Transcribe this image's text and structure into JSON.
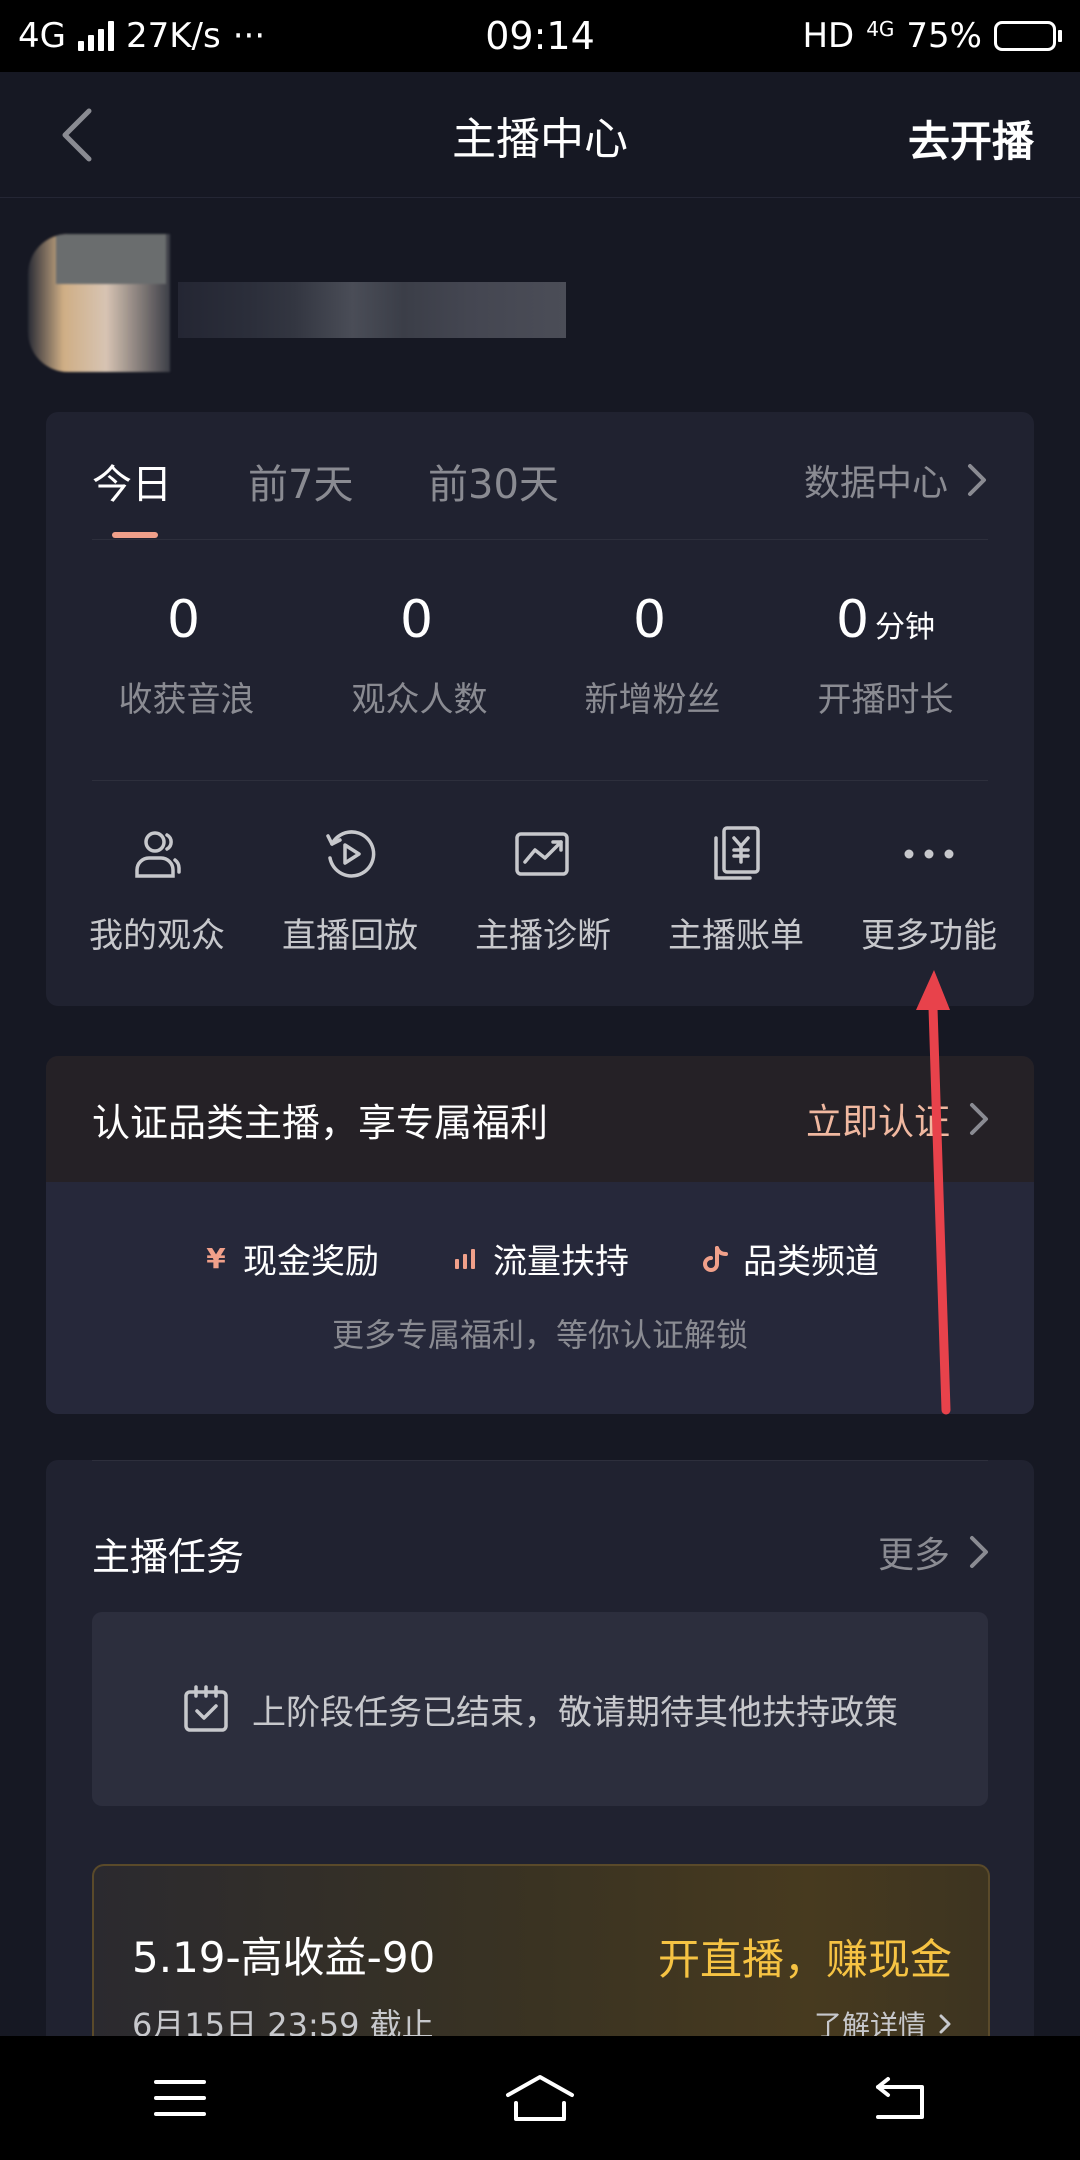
{
  "status_bar": {
    "network": "4G",
    "speed": "27K/s",
    "more": "···",
    "time": "09:14",
    "hd": "HD",
    "net2": "4G",
    "battery": "75%",
    "battery_level": 0.75
  },
  "header": {
    "title": "主播中心",
    "action": "去开播"
  },
  "stats": {
    "tabs": [
      "今日",
      "前7天",
      "前30天"
    ],
    "active_tab": 0,
    "data_center": "数据中心",
    "items": [
      {
        "value": "0",
        "unit": "",
        "label": "收获音浪"
      },
      {
        "value": "0",
        "unit": "",
        "label": "观众人数"
      },
      {
        "value": "0",
        "unit": "",
        "label": "新增粉丝"
      },
      {
        "value": "0",
        "unit": "分钟",
        "label": "开播时长"
      }
    ]
  },
  "tools": [
    {
      "label": "我的观众",
      "icon": "audience-icon"
    },
    {
      "label": "直播回放",
      "icon": "replay-icon"
    },
    {
      "label": "主播诊断",
      "icon": "diagnosis-icon"
    },
    {
      "label": "主播账单",
      "icon": "bill-icon"
    },
    {
      "label": "更多功能",
      "icon": "more-icon"
    }
  ],
  "certification": {
    "title": "认证品类主播，享专属福利",
    "action": "立即认证",
    "benefits": [
      {
        "label": "现金奖励",
        "icon": "yen-icon"
      },
      {
        "label": "流量扶持",
        "icon": "bars-icon"
      },
      {
        "label": "品类频道",
        "icon": "music-note-icon"
      }
    ],
    "note": "更多专属福利，等你认证解锁"
  },
  "tasks": {
    "title": "主播任务",
    "more": "更多",
    "empty_text": "上阶段任务已结束，敬请期待其他扶持政策",
    "promo": {
      "title": "5.19-高收益-90",
      "deadline": "6月15日 23:59 截止",
      "cta": "开直播，赚现金",
      "detail": "了解详情"
    }
  },
  "colors": {
    "background": "#161823",
    "card": "#202230",
    "accent": "#f0a08a",
    "gold": "#f6c343",
    "annotation": "#e8424b"
  }
}
